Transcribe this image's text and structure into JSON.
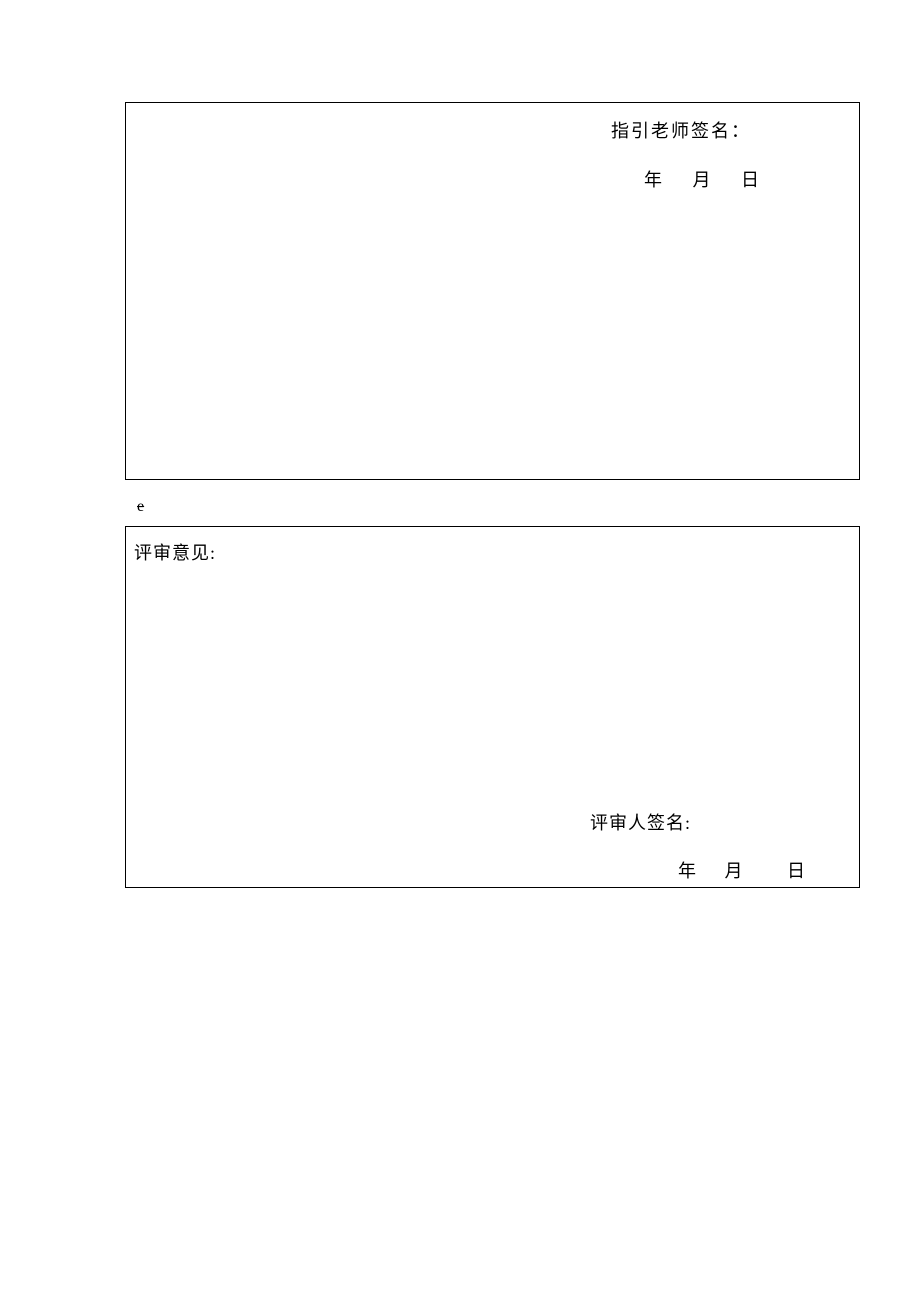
{
  "box1": {
    "signature_label": "指引老师签名：",
    "date": {
      "year": "年",
      "month": "月",
      "day": "日"
    }
  },
  "marker": "e",
  "box2": {
    "title": "评审意见:",
    "signature_label": "评审人签名:",
    "date": {
      "year": "年",
      "month": "月",
      "day": "日"
    }
  }
}
